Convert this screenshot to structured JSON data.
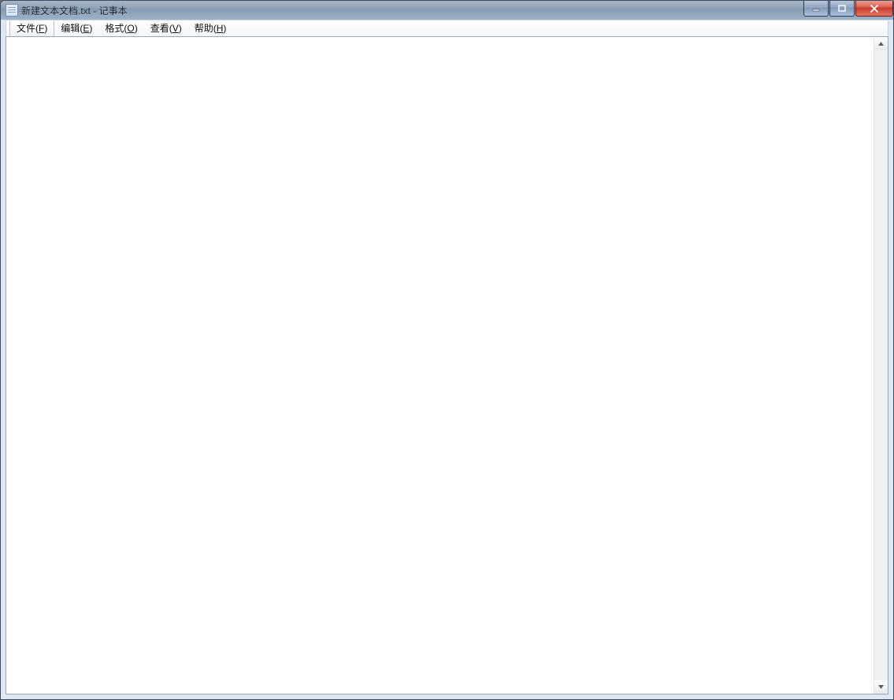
{
  "window": {
    "title": "新建文本文档.txt - 记事本"
  },
  "menu": {
    "items": [
      {
        "label_pre": "文件(",
        "accel": "F",
        "label_post": ")"
      },
      {
        "label_pre": "编辑(",
        "accel": "E",
        "label_post": ")"
      },
      {
        "label_pre": "格式(",
        "accel": "O",
        "label_post": ")"
      },
      {
        "label_pre": "查看(",
        "accel": "V",
        "label_post": ")"
      },
      {
        "label_pre": "帮助(",
        "accel": "H",
        "label_post": ")"
      }
    ]
  },
  "editor": {
    "content": ""
  }
}
